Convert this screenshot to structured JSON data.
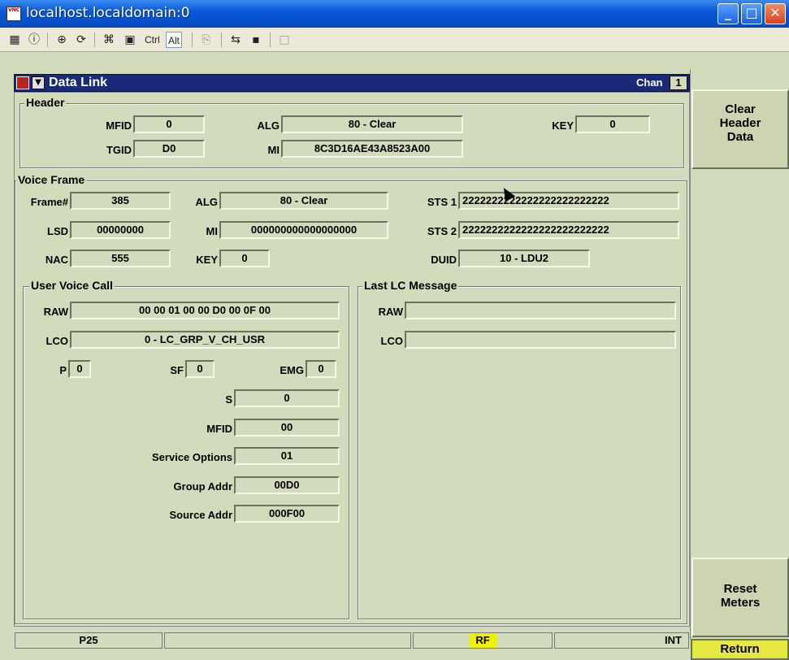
{
  "window": {
    "title": "localhost.localdomain:0",
    "icon_text": "VNC"
  },
  "toolbar": {
    "ctrl_label": "Ctrl",
    "alt_label": "Alt"
  },
  "panel": {
    "title": "Data Link",
    "chan_label": "Chan",
    "chan_value": "1"
  },
  "header": {
    "title": "Header",
    "mfid_label": "MFID",
    "mfid_value": "0",
    "alg_label": "ALG",
    "alg_value": "80 - Clear",
    "key_label": "KEY",
    "key_value": "0",
    "tgid_label": "TGID",
    "tgid_value": "D0",
    "mi_label": "MI",
    "mi_value": "8C3D16AE43A8523A00"
  },
  "voice_frame": {
    "title": "Voice Frame",
    "frame_label": "Frame#",
    "frame_value": "385",
    "alg_label": "ALG",
    "alg_value": "80 - Clear",
    "sts1_label": "STS 1",
    "sts1_value": "2222222222222222222222222",
    "lsd_label": "LSD",
    "lsd_value": "00000000",
    "mi_label": "MI",
    "mi_value": "000000000000000000",
    "sts2_label": "STS 2",
    "sts2_value": "2222222222222222222222222",
    "nac_label": "NAC",
    "nac_value": "555",
    "key_label": "KEY",
    "key_value": "0",
    "duid_label": "DUID",
    "duid_value": "10 - LDU2"
  },
  "user_voice_call": {
    "title": "User Voice Call",
    "raw_label": "RAW",
    "raw_value": "00 00 01 00 00 D0 00 0F 00",
    "lco_label": "LCO",
    "lco_value": "0 - LC_GRP_V_CH_USR",
    "p_label": "P",
    "p_value": "0",
    "sf_label": "SF",
    "sf_value": "0",
    "emg_label": "EMG",
    "emg_value": "0",
    "s_label": "S",
    "s_value": "0",
    "mfid_label": "MFID",
    "mfid_value": "00",
    "service_options_label": "Service Options",
    "service_options_value": "01",
    "group_addr_label": "Group Addr",
    "group_addr_value": "00D0",
    "source_addr_label": "Source Addr",
    "source_addr_value": "000F00"
  },
  "last_lc": {
    "title": "Last LC Message",
    "raw_label": "RAW",
    "raw_value": "",
    "lco_label": "LCO",
    "lco_value": ""
  },
  "side": {
    "clear_header_lines": [
      "Clear",
      "Header",
      "Data"
    ],
    "reset_meters_lines": [
      "Reset",
      "Meters"
    ],
    "return_label": "Return"
  },
  "status": {
    "mode": "P25",
    "rf": "RF",
    "int": "INT"
  },
  "colors": {
    "titlebar": "#0a58d8",
    "panel_bg": "#d3dbbd",
    "panel_title": "#1a2a78",
    "rf_highlight": "#f0f000",
    "return_bg": "#e4e840"
  }
}
